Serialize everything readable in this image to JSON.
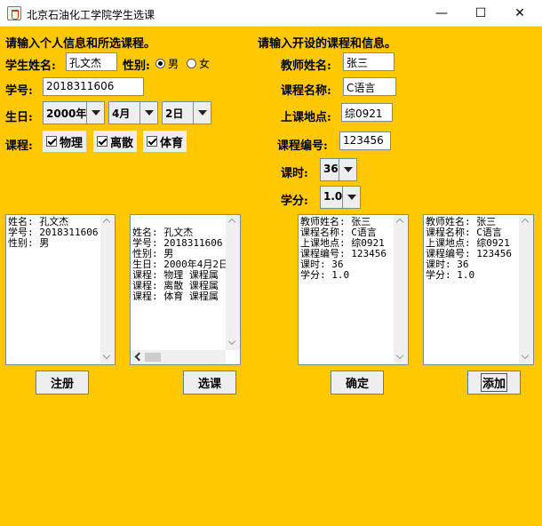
{
  "window": {
    "title": "北京石油化工学院学生选课",
    "minimize": "—",
    "maximize": "☐",
    "close": "✕"
  },
  "left": {
    "header": "请输入个人信息和所选课程。",
    "name_label": "学生姓名:",
    "name_value": "孔文杰",
    "gender_label": "性别:",
    "gender_options": [
      "男",
      "女"
    ],
    "gender_selected": "男",
    "id_label": "学号:",
    "id_value": "2018311606",
    "birth_label": "生日:",
    "year": "2000年",
    "month": "4月",
    "day": "2日",
    "course_label": "课程:",
    "courses": [
      "物理",
      "离散",
      "体育"
    ]
  },
  "right": {
    "header": "请输入开设的课程和信息。",
    "teacher_label": "教师姓名:",
    "teacher_value": "张三",
    "course_name_label": "课程名称:",
    "course_name_value": "C语言",
    "location_label": "上课地点:",
    "location_value": "综0921",
    "course_id_label": "课程编号:",
    "course_id_value": "123456",
    "hours_label": "课时:",
    "hours_value": "36",
    "credit_label": "学分:",
    "credit_value": "1.0"
  },
  "outputs": {
    "register": "姓名: 孔文杰\n学号: 2018311606\n性别: 男",
    "select": "姓名: 孔文杰\n学号: 2018311606\n性别: 男\n生日: 2000年4月2日\n课程: 物理 课程属\n课程: 离散 课程属\n课程: 体育 课程属",
    "confirm": "教师姓名: 张三\n课程名称: C语言\n上课地点: 综0921\n课程编号: 123456\n课时: 36\n学分: 1.0",
    "add": "教师姓名: 张三\n课程名称: C语言\n上课地点: 综0921\n课程编号: 123456\n课时: 36\n学分: 1.0"
  },
  "buttons": {
    "register": "注册",
    "select": "选课",
    "confirm": "确定",
    "add": "添加"
  },
  "colors": {
    "background": "#ffc800",
    "titlebar": "#ffffff"
  }
}
